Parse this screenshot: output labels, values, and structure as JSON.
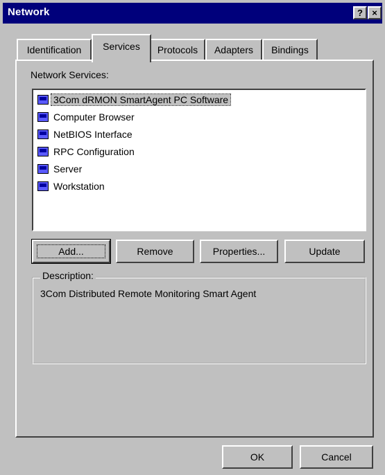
{
  "window": {
    "title": "Network"
  },
  "title_buttons": {
    "help": "?",
    "close": "×"
  },
  "tabs": [
    "Identification",
    "Services",
    "Protocols",
    "Adapters",
    "Bindings"
  ],
  "active_tab": "Services",
  "services_panel": {
    "list_label": "Network Services:",
    "items": [
      "3Com dRMON SmartAgent PC Software",
      "Computer Browser",
      "NetBIOS Interface",
      "RPC Configuration",
      "Server",
      "Workstation"
    ],
    "selected_item": "3Com dRMON SmartAgent PC Software",
    "buttons": {
      "add": "Add...",
      "remove": "Remove",
      "properties": "Properties...",
      "update": "Update"
    },
    "description_label": "Description:",
    "description_text": "3Com Distributed Remote Monitoring Smart Agent"
  },
  "footer_buttons": {
    "ok": "OK",
    "cancel": "Cancel"
  }
}
